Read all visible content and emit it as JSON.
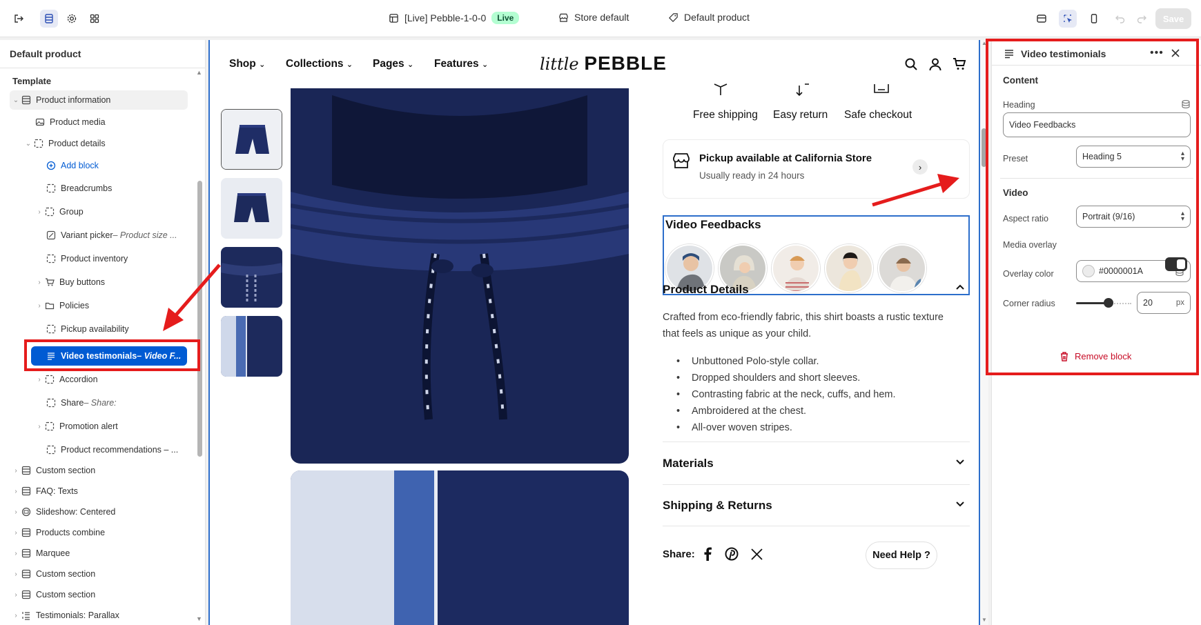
{
  "topbar": {
    "theme_title": "[Live] Pebble-1-0-0",
    "live_badge": "Live",
    "store": "Store default",
    "template": "Default product",
    "save_label": "Save"
  },
  "left_panel": {
    "title": "Default product",
    "template_label": "Template",
    "items": [
      {
        "label": "Product information",
        "sub": ""
      },
      {
        "label": "Product media",
        "sub": ""
      },
      {
        "label": "Product details",
        "sub": ""
      },
      {
        "label": "Add block",
        "sub": ""
      },
      {
        "label": "Breadcrumbs",
        "sub": ""
      },
      {
        "label": "Group",
        "sub": ""
      },
      {
        "label": "Variant picker",
        "sub": " – Product size ..."
      },
      {
        "label": "Product inventory",
        "sub": ""
      },
      {
        "label": "Buy buttons",
        "sub": ""
      },
      {
        "label": "Policies",
        "sub": ""
      },
      {
        "label": "Pickup availability",
        "sub": ""
      },
      {
        "label": "Video testimonials",
        "sub": " – Video F..."
      },
      {
        "label": "Accordion",
        "sub": ""
      },
      {
        "label": "Share",
        "sub": " – Share:"
      },
      {
        "label": "Promotion alert",
        "sub": ""
      },
      {
        "label": "Product recommendations – ...",
        "sub": ""
      }
    ],
    "sections": [
      "Custom section",
      "FAQ: Texts",
      "Slideshow: Centered",
      "Products combine",
      "Marquee",
      "Custom section",
      "Custom section",
      "Testimonials: Parallax"
    ]
  },
  "store": {
    "nav": [
      "Shop",
      "Collections",
      "Pages",
      "Features"
    ],
    "logo_small": "little",
    "logo_big": "PEBBLE",
    "perks": [
      "Free shipping",
      "Easy return",
      "Safe checkout"
    ],
    "pickup_title": "Pickup available at California Store",
    "pickup_sub": "Usually ready in 24 hours",
    "video_heading": "Video Feedbacks",
    "product_details_title": "Product Details",
    "description": "Crafted from eco-friendly fabric, this shirt boasts a rustic texture that feels as unique as your child.",
    "bullets": [
      "Unbuttoned Polo-style collar.",
      "Dropped shoulders and short sleeves.",
      "Contrasting fabric at the neck, cuffs, and hem.",
      "Ambroidered at the chest.",
      "All-over woven stripes."
    ],
    "materials_title": "Materials",
    "shipping_title": "Shipping & Returns",
    "share_label": "Share:",
    "need_help": "Need Help ?"
  },
  "right_panel": {
    "title": "Video testimonials",
    "content_label": "Content",
    "heading_label": "Heading",
    "heading_value": "Video Feedbacks",
    "preset_label": "Preset",
    "preset_value": "Heading 5",
    "video_label": "Video",
    "aspect_label": "Aspect ratio",
    "aspect_value": "Portrait (9/16)",
    "overlay_label": "Media overlay",
    "overlay_enabled": true,
    "overlay_color_label": "Overlay color",
    "overlay_color_value": "#0000001A",
    "corner_label": "Corner radius",
    "corner_value": "20",
    "corner_unit": "px",
    "remove_label": "Remove block"
  },
  "colors": {
    "accent": "#005bd3",
    "highlight_border": "#e51c1c",
    "navy": "#1d2a5c"
  }
}
